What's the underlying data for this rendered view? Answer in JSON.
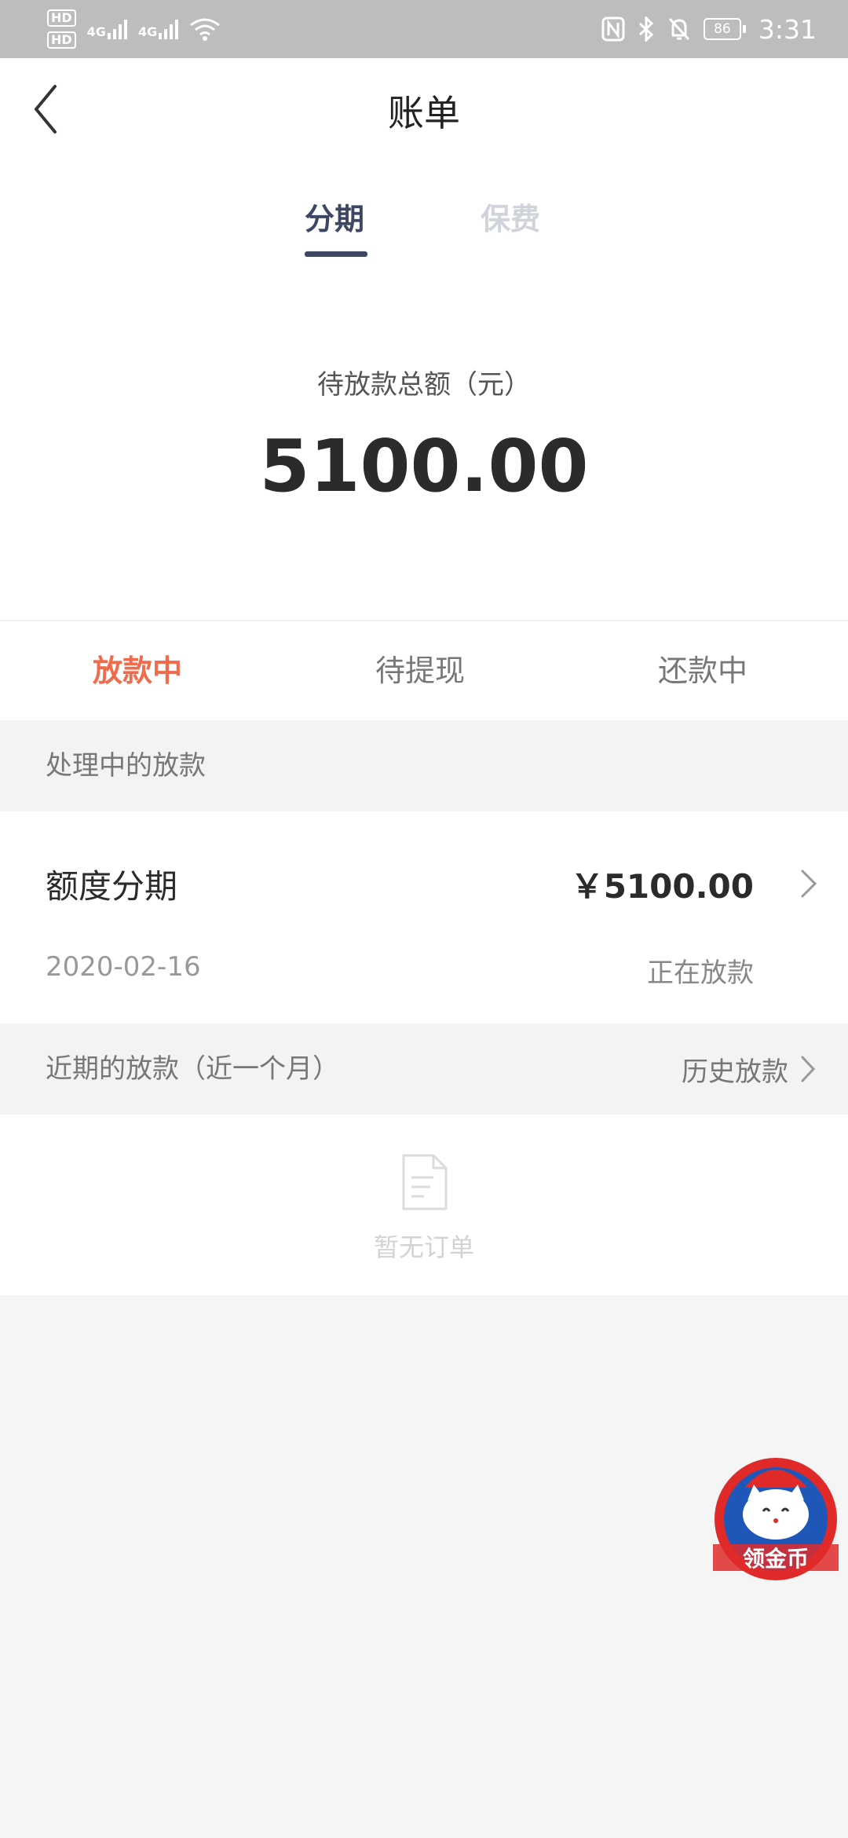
{
  "status_bar": {
    "hd_top": "HD",
    "hd_bottom": "HD",
    "net1": "4G",
    "net2": "4G",
    "battery": "86",
    "time": "3:31"
  },
  "nav": {
    "title": "账单"
  },
  "top_tabs": {
    "tab1": "分期",
    "tab2": "保费"
  },
  "summary": {
    "label": "待放款总额（元）",
    "amount": "5100.00"
  },
  "status_tabs": {
    "tab1": "放款中",
    "tab2": "待提现",
    "tab3": "还款中"
  },
  "processing": {
    "header": "处理中的放款",
    "item": {
      "name": "额度分期",
      "amount": "￥5100.00",
      "date": "2020-02-16",
      "status": "正在放款"
    }
  },
  "recent": {
    "header": "近期的放款（近一个月）",
    "history_link": "历史放款",
    "empty_text": "暂无订单"
  },
  "float_badge": {
    "label": "领金币"
  },
  "colors": {
    "accent": "#f06a4c",
    "tab_active": "#3d4663",
    "status_bar": "#bdbdbd"
  }
}
